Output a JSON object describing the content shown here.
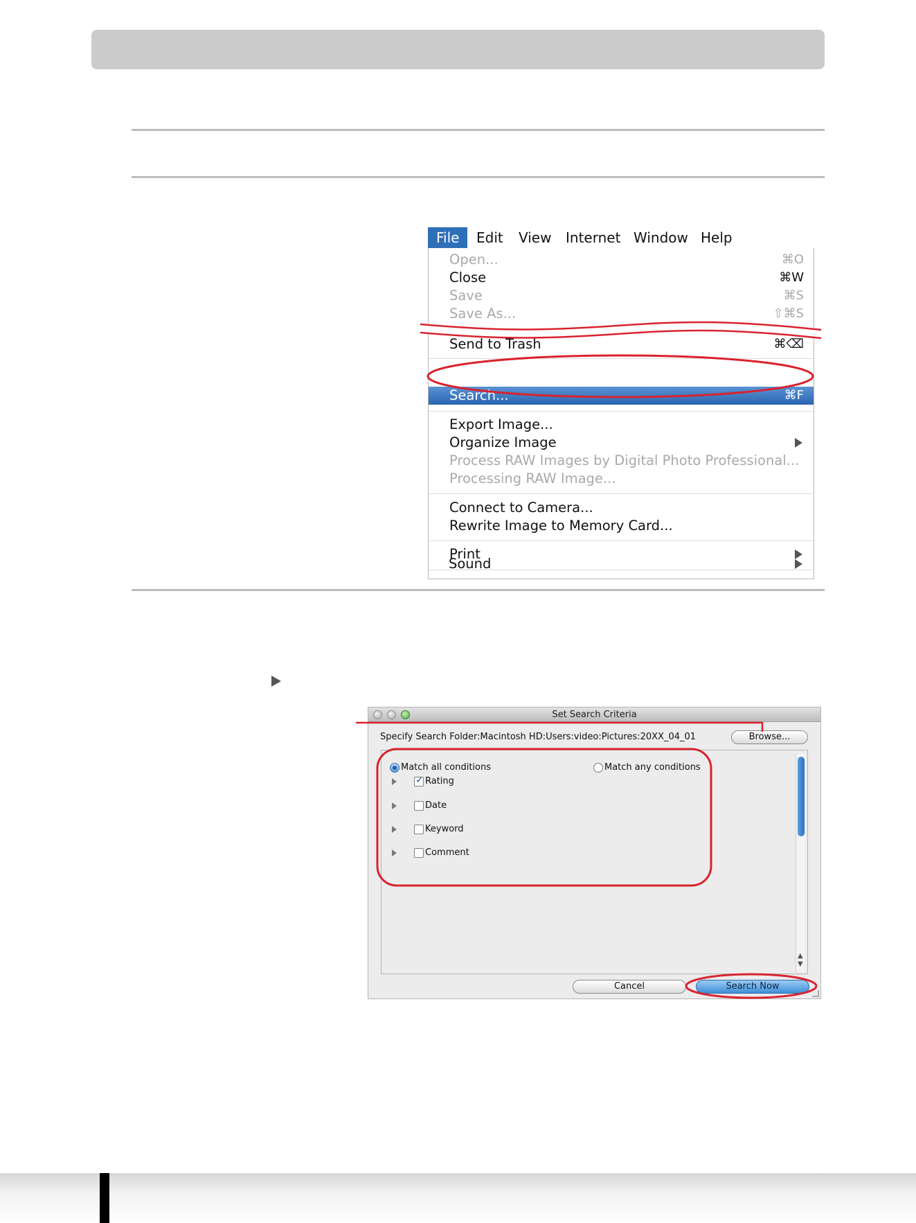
{
  "menu": {
    "menubar": [
      "File",
      "Edit",
      "View",
      "Internet",
      "Window",
      "Help"
    ],
    "items": [
      {
        "label": "Open...",
        "shortcut": "⌘O",
        "enabled": false
      },
      {
        "label": "Close",
        "shortcut": "⌘W",
        "enabled": true
      },
      {
        "label": "Save",
        "shortcut": "⌘S",
        "enabled": false
      },
      {
        "label": "Save As...",
        "shortcut": "⇧⌘S",
        "enabled": false
      },
      {
        "label": "Send to Trash",
        "shortcut": "⌘⌫",
        "enabled": true
      },
      {
        "label": "Search...",
        "shortcut": "⌘F",
        "enabled": true,
        "highlighted": true
      },
      {
        "label": "Export Image...",
        "enabled": true
      },
      {
        "label": "Organize Image",
        "enabled": true,
        "submenu": true
      },
      {
        "label": "Process RAW Images by Digital Photo Professional...",
        "enabled": false
      },
      {
        "label": "Processing RAW Image...",
        "enabled": false
      },
      {
        "label": "Connect to Camera...",
        "enabled": true
      },
      {
        "label": "Rewrite Image to Memory Card...",
        "enabled": true
      },
      {
        "label": "Print",
        "enabled": true,
        "submenu": true
      },
      {
        "label": "Sound",
        "enabled": true,
        "submenu": true
      }
    ]
  },
  "dialog": {
    "title": "Set Search Criteria",
    "folder_label": "Specify Search Folder:Macintosh HD:Users:video:Pictures:20XX_04_01",
    "browse_button": "Browse...",
    "match_all": "Match all conditions",
    "match_any": "Match any conditions",
    "match_mode": "all",
    "criteria": [
      {
        "label": "Rating",
        "checked": true
      },
      {
        "label": "Date",
        "checked": false
      },
      {
        "label": "Keyword",
        "checked": false
      },
      {
        "label": "Comment",
        "checked": false
      }
    ],
    "cancel_button": "Cancel",
    "search_button": "Search Now"
  },
  "colors": {
    "highlight_ring": "#d9232e",
    "menu_selection": "#2f6fb8"
  }
}
